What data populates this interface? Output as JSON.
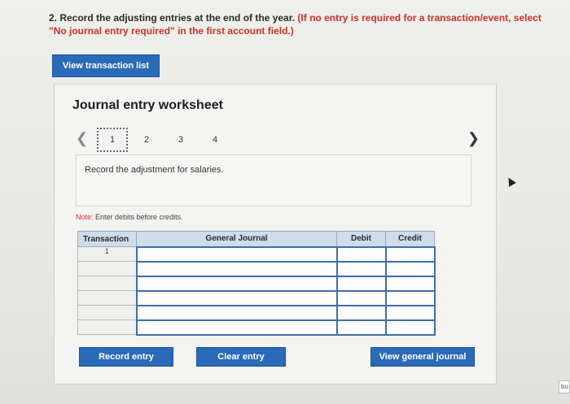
{
  "instructions": {
    "prefix": "2. Record the adjusting entries at the end of the year.",
    "note": "(If no entry is required for a transaction/event, select \"No journal entry required\" in the first account field.)"
  },
  "view_transaction_list": "View transaction list",
  "worksheet": {
    "title": "Journal entry worksheet",
    "pages": [
      "1",
      "2",
      "3",
      "4"
    ],
    "active_page": "1",
    "prompt": "Record the adjustment for salaries.",
    "note_label": "Note:",
    "note_text": " Enter debits before credits."
  },
  "table": {
    "headers": [
      "Transaction",
      "General Journal",
      "Debit",
      "Credit"
    ],
    "first_transaction": "1"
  },
  "buttons": {
    "record": "Record entry",
    "clear": "Clear entry",
    "view_general_journal": "View general journal"
  },
  "corner_tag": "bu",
  "colors": {
    "button_blue": "#2a6ab8",
    "note_red": "#c8322a",
    "header_bg": "#cfdcec"
  }
}
